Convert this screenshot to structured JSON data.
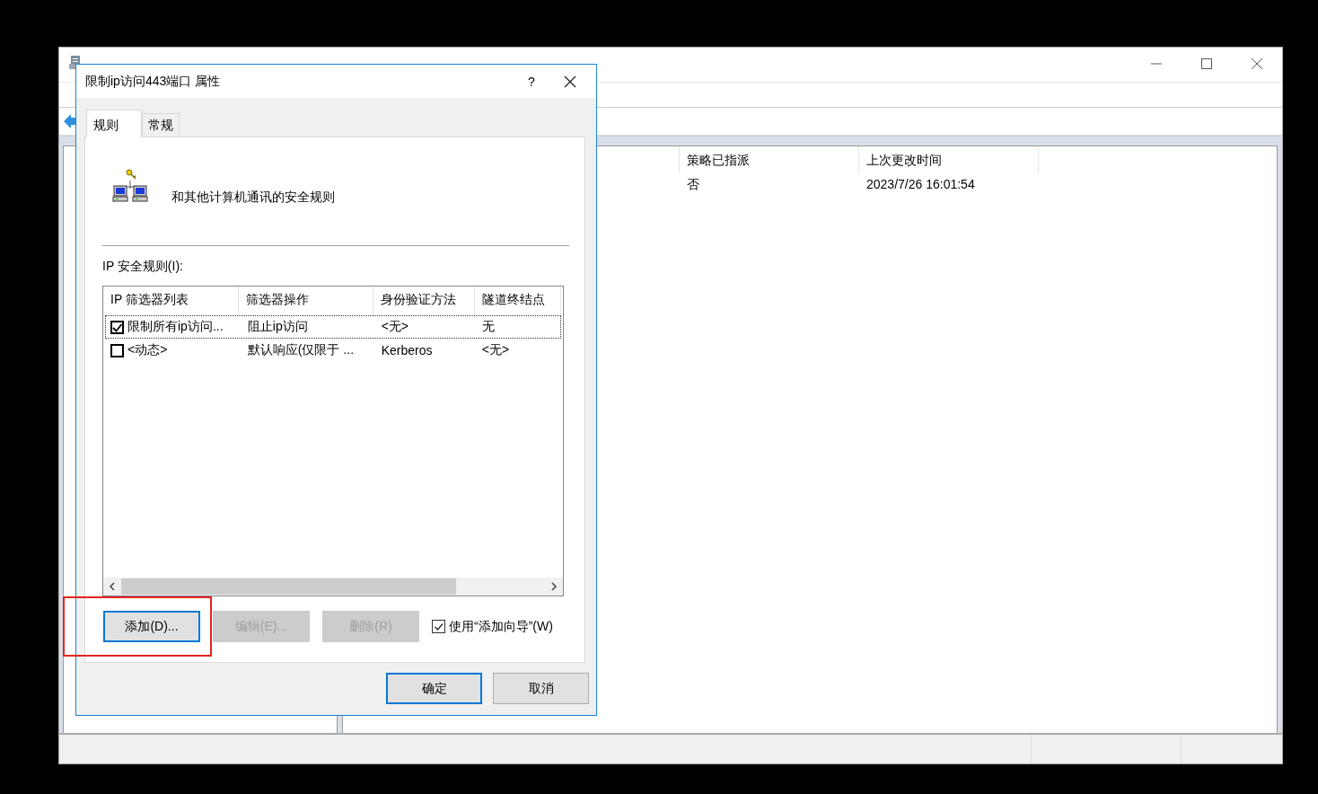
{
  "main_window": {
    "table": {
      "columns": [
        "策略已指派",
        "上次更改时间"
      ],
      "rows": [
        [
          "否",
          "2023/7/26 16:01:54"
        ]
      ]
    }
  },
  "dialog": {
    "title": "限制ip访问443端口 属性",
    "help": "?",
    "tabs": [
      {
        "label": "规则",
        "selected": true
      },
      {
        "label": "常规",
        "selected": false
      }
    ],
    "description": "和其他计算机通讯的安全规则",
    "rules_label": "IP 安全规则(I):",
    "rules_table": {
      "columns": [
        "IP 筛选器列表",
        "筛选器操作",
        "身份验证方法",
        "隧道终结点"
      ],
      "rows": [
        {
          "checked": true,
          "focused": true,
          "cells": [
            "限制所有ip访问...",
            "阻止ip访问",
            "<无>",
            "无"
          ]
        },
        {
          "checked": false,
          "focused": false,
          "cells": [
            "<动态>",
            "默认响应(仅限于 ...",
            "Kerberos",
            "<无>"
          ]
        }
      ]
    },
    "buttons": [
      {
        "label": "添加(D)...",
        "disabled": false,
        "focused": true
      },
      {
        "label": "编辑(E)...",
        "disabled": true,
        "focused": false
      },
      {
        "label": "删除(R)",
        "disabled": true,
        "focused": false
      }
    ],
    "wizard_checkbox": {
      "label": "使用“添加向导”(W)",
      "checked": true
    },
    "footer_buttons": [
      {
        "label": "确定",
        "default": true
      },
      {
        "label": "取消",
        "default": false
      }
    ]
  }
}
